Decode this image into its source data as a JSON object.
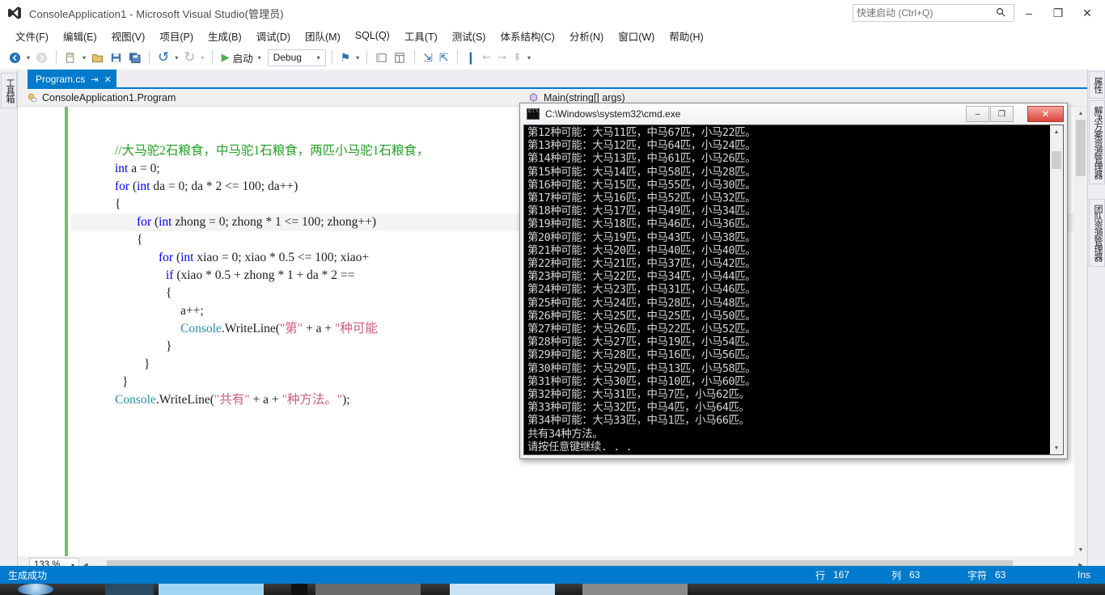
{
  "titlebar": {
    "app_title": "ConsoleApplication1 - Microsoft Visual Studio(管理员)",
    "logo_name": "visual-studio-logo",
    "quick_launch_placeholder": "快速启动 (Ctrl+Q)",
    "quick_launch_value": "",
    "minimize": "–",
    "maximize": "❐",
    "close": "✕"
  },
  "menu": {
    "items": [
      "文件(F)",
      "编辑(E)",
      "视图(V)",
      "项目(P)",
      "生成(B)",
      "调试(D)",
      "团队(M)",
      "SQL(Q)",
      "工具(T)",
      "测试(S)",
      "体系结构(C)",
      "分析(N)",
      "窗口(W)",
      "帮助(H)"
    ]
  },
  "toolbar": {
    "back_label": "⬅",
    "forward_label": "➡",
    "new_project_label": "▤",
    "open_file_label": "▣",
    "save_label": "💾",
    "save_all_label": "🖫",
    "undo_label": "↶",
    "redo_label": "↷",
    "start_glyph": "▶",
    "start_label": "启动",
    "config_value": "Debug",
    "caret": "▾",
    "attach_label": "⚑",
    "win1_label": "▥",
    "win2_label": "▨",
    "step1_label": "↳",
    "step2_label": "↱",
    "bookmark_label": "❚",
    "more_label": "⋮"
  },
  "docks": {
    "left": [
      "工具箱"
    ],
    "right": [
      "属性",
      "解决方案资源管理器",
      "团队资源管理器"
    ]
  },
  "editor": {
    "tab_label": "Program.cs",
    "tab_pin_icon": "📌",
    "tab_close_icon": "✕",
    "nav_type": "ConsoleApplication1.Program",
    "nav_type_icon": "class-icon",
    "nav_member": "Main(string[] args)",
    "nav_member_icon": "method-icon",
    "zoom_level": "133 %",
    "code_lines": [
      {
        "indent": 0,
        "tokens": []
      },
      {
        "indent": 0,
        "tokens": []
      },
      {
        "indent": 6,
        "tokens": [
          {
            "t": "//大马驼2石粮食，中马驼1石粮食，两匹小马驼1石粮食，",
            "c": "cm"
          }
        ]
      },
      {
        "indent": 6,
        "tokens": [
          {
            "t": "int",
            "c": "k"
          },
          {
            "t": " a = 0;",
            "c": ""
          }
        ]
      },
      {
        "indent": 6,
        "tokens": [
          {
            "t": "for",
            "c": "k"
          },
          {
            "t": " (",
            "c": ""
          },
          {
            "t": "int",
            "c": "k"
          },
          {
            "t": " da = 0; da * 2 <= 100; da++)",
            "c": ""
          }
        ]
      },
      {
        "indent": 6,
        "tokens": [
          {
            "t": "{",
            "c": ""
          }
        ]
      },
      {
        "indent": 9,
        "tokens": [
          {
            "t": "for",
            "c": "k"
          },
          {
            "t": " (",
            "c": ""
          },
          {
            "t": "int",
            "c": "k"
          },
          {
            "t": " zhong = 0; zhong * 1 <= 100; zhong++)",
            "c": ""
          }
        ],
        "hl": true
      },
      {
        "indent": 9,
        "tokens": [
          {
            "t": "{",
            "c": ""
          }
        ]
      },
      {
        "indent": 12,
        "tokens": [
          {
            "t": "for",
            "c": "k"
          },
          {
            "t": " (",
            "c": ""
          },
          {
            "t": "int",
            "c": "k"
          },
          {
            "t": " xiao = 0; xiao * 0.5 <= 100; xiao+",
            "c": ""
          }
        ]
      },
      {
        "indent": 13,
        "tokens": [
          {
            "t": "if",
            "c": "k"
          },
          {
            "t": " (xiao * 0.5 + zhong * 1 + da * 2 ==",
            "c": ""
          }
        ]
      },
      {
        "indent": 13,
        "tokens": [
          {
            "t": "{",
            "c": ""
          }
        ]
      },
      {
        "indent": 15,
        "tokens": [
          {
            "t": "a++;",
            "c": ""
          }
        ]
      },
      {
        "indent": 15,
        "tokens": [
          {
            "t": "Console",
            "c": "ty"
          },
          {
            "t": ".WriteLine(",
            "c": ""
          },
          {
            "t": "\"第\"",
            "c": "st"
          },
          {
            "t": " + a + ",
            "c": ""
          },
          {
            "t": "\"种可能",
            "c": "st"
          }
        ]
      },
      {
        "indent": 13,
        "tokens": [
          {
            "t": "}",
            "c": ""
          }
        ]
      },
      {
        "indent": 10,
        "tokens": [
          {
            "t": "}",
            "c": ""
          }
        ]
      },
      {
        "indent": 7,
        "tokens": [
          {
            "t": "}",
            "c": ""
          }
        ]
      },
      {
        "indent": 6,
        "tokens": [
          {
            "t": "Console",
            "c": "ty"
          },
          {
            "t": ".WriteLine(",
            "c": ""
          },
          {
            "t": "\"共有\"",
            "c": "st"
          },
          {
            "t": " + a + ",
            "c": ""
          },
          {
            "t": "\"种方法。\"",
            "c": "st"
          },
          {
            "t": ");",
            "c": ""
          }
        ]
      }
    ]
  },
  "statusbar": {
    "message": "生成成功",
    "line_label": "行",
    "line_value": "167",
    "col_label": "列",
    "col_value": "63",
    "char_label": "字符",
    "char_value": "63",
    "insert_mode": "Ins"
  },
  "cmd": {
    "title": "C:\\Windows\\system32\\cmd.exe",
    "icon_name": "cmd-icon",
    "minimize": "–",
    "maximize": "❐",
    "close": "✕",
    "lines": [
      "第12种可能：大马11匹，中马67匹，小马22匹。",
      "第13种可能：大马12匹，中马64匹，小马24匹。",
      "第14种可能：大马13匹，中马61匹，小马26匹。",
      "第15种可能：大马14匹，中马58匹，小马28匹。",
      "第16种可能：大马15匹，中马55匹，小马30匹。",
      "第17种可能：大马16匹，中马52匹，小马32匹。",
      "第18种可能：大马17匹，中马49匹，小马34匹。",
      "第19种可能：大马18匹，中马46匹，小马36匹。",
      "第20种可能：大马19匹，中马43匹，小马38匹。",
      "第21种可能：大马20匹，中马40匹，小马40匹。",
      "第22种可能：大马21匹，中马37匹，小马42匹。",
      "第23种可能：大马22匹，中马34匹，小马44匹。",
      "第24种可能：大马23匹，中马31匹，小马46匹。",
      "第25种可能：大马24匹，中马28匹，小马48匹。",
      "第26种可能：大马25匹，中马25匹，小马50匹。",
      "第27种可能：大马26匹，中马22匹，小马52匹。",
      "第28种可能：大马27匹，中马19匹，小马54匹。",
      "第29种可能：大马28匹，中马16匹，小马56匹。",
      "第30种可能：大马29匹，中马13匹，小马58匹。",
      "第31种可能：大马30匹，中马10匹，小马60匹。",
      "第32种可能：大马31匹，中马7匹，小马62匹。",
      "第33种可能：大马32匹，中马4匹，小马64匹。",
      "第34种可能：大马33匹，中马1匹，小马66匹。",
      "共有34种方法。",
      "请按任意键继续. . ."
    ]
  },
  "colors": {
    "accent": "#007acc",
    "titlebar_bg": "#ffffff",
    "dock_bg": "#eeeef2",
    "console_bg": "#000000",
    "console_fg": "#d8d8d8"
  }
}
